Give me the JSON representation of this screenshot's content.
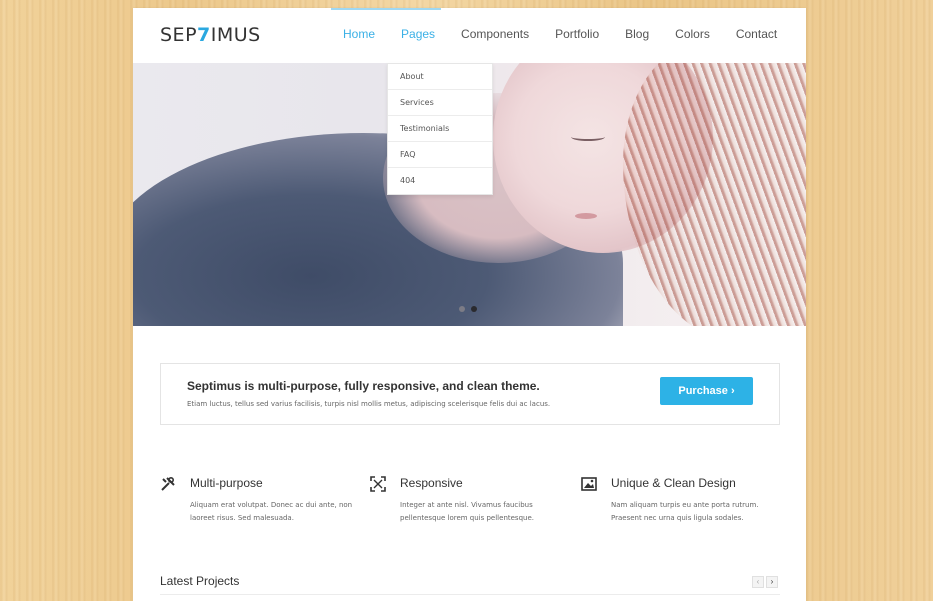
{
  "site": {
    "logo_prefix": "SEP",
    "logo_seven": "7",
    "logo_suffix": "IMUS"
  },
  "nav": {
    "items": [
      {
        "label": "Home"
      },
      {
        "label": "Pages"
      },
      {
        "label": "Components"
      },
      {
        "label": "Portfolio"
      },
      {
        "label": "Blog"
      },
      {
        "label": "Colors"
      },
      {
        "label": "Contact"
      }
    ],
    "active": "Home",
    "open_menu": "Pages",
    "dropdown": [
      "About",
      "Services",
      "Testimonials",
      "FAQ",
      "404"
    ]
  },
  "slider": {
    "dots": 2,
    "active_dot": 2
  },
  "callout": {
    "title": "Septimus is multi-purpose, fully responsive, and clean theme.",
    "text": "Etiam luctus, tellus sed varius facilisis, turpis nisl mollis metus, adipiscing scelerisque felis dui ac lacus.",
    "button": "Purchase ›"
  },
  "features": [
    {
      "icon": "tools-icon",
      "title": "Multi-purpose",
      "text": "Aliquam erat volutpat. Donec ac dui ante, non laoreet risus. Sed malesuada."
    },
    {
      "icon": "expand-icon",
      "title": "Responsive",
      "text": "Integer at ante nisl. Vivamus faucibus pellentesque lorem quis pellentesque."
    },
    {
      "icon": "image-icon",
      "title": "Unique & Clean Design",
      "text": "Nam aliquam turpis eu ante porta rutrum. Praesent nec urna quis ligula sodales."
    }
  ],
  "latest": {
    "title": "Latest Projects",
    "prev": "‹",
    "next": "›"
  },
  "colors": {
    "accent": "#2db2e6",
    "nav_active": "#3ab0e6",
    "background_wood": "#f0d09a"
  }
}
